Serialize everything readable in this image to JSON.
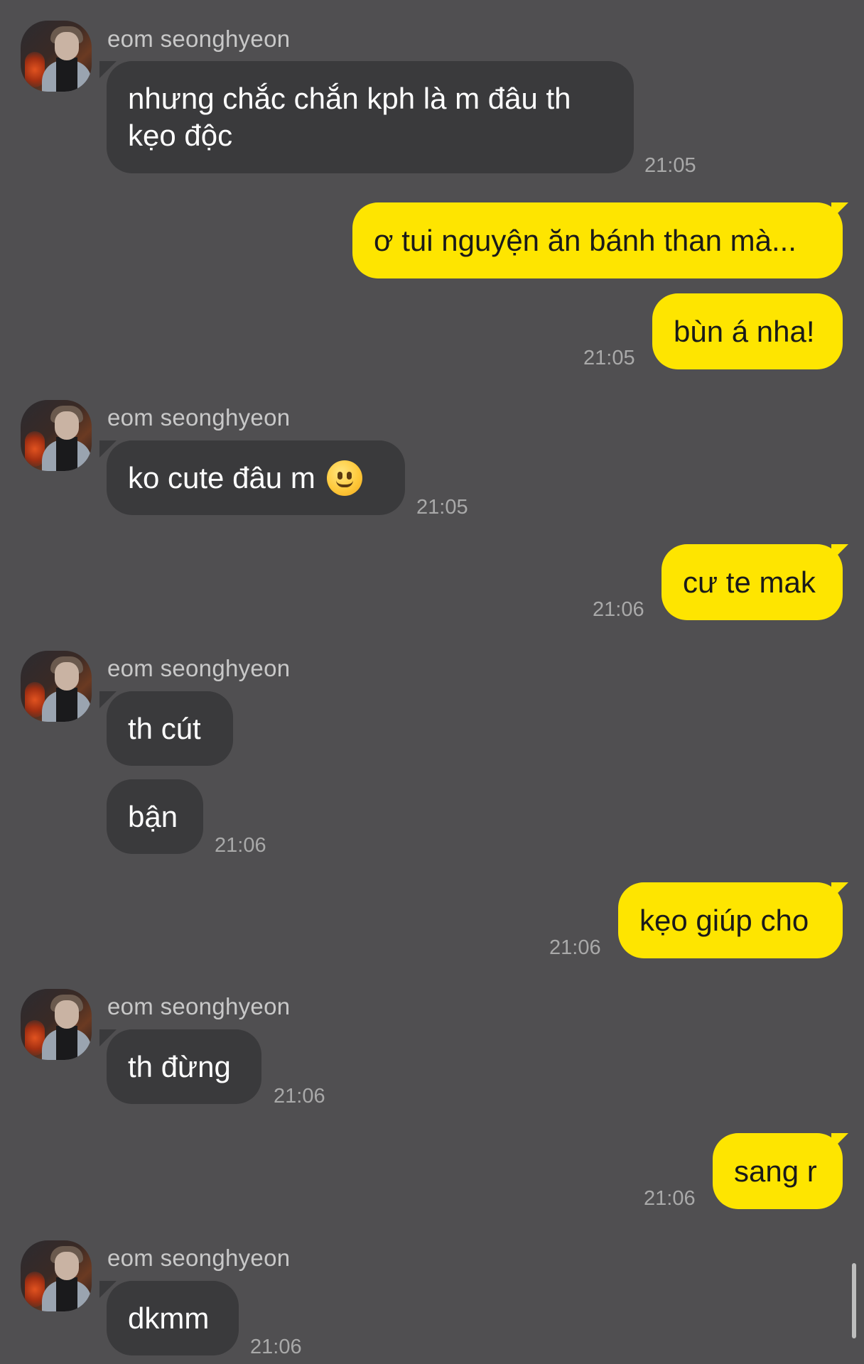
{
  "contact": {
    "name": "eom seonghyeon"
  },
  "messages": [
    {
      "from": "them",
      "text": "nhưng chắc chắn kph là m đâu th kẹo độc",
      "time": "21:05"
    },
    {
      "from": "me",
      "text": "ơ tui nguyện ăn bánh than mà...",
      "time": ""
    },
    {
      "from": "me",
      "text": "bùn á nha!",
      "time": "21:05"
    },
    {
      "from": "them",
      "text": "ko cute đâu m",
      "emoji": "slightly-smiling-face-icon",
      "time": "21:05"
    },
    {
      "from": "me",
      "text": "cư te mak",
      "time": "21:06"
    },
    {
      "from": "them",
      "text": "th cút",
      "time": ""
    },
    {
      "from": "them",
      "text": "bận",
      "time": "21:06"
    },
    {
      "from": "me",
      "text": "kẹo giúp cho",
      "time": "21:06"
    },
    {
      "from": "them",
      "text": "th đừng",
      "time": "21:06"
    },
    {
      "from": "me",
      "text": "sang r",
      "time": "21:06"
    },
    {
      "from": "them",
      "text": "dkmm",
      "time": "21:06"
    }
  ],
  "colors": {
    "background": "#504f51",
    "their_bubble": "#3a3a3c",
    "my_bubble": "#fee500"
  }
}
